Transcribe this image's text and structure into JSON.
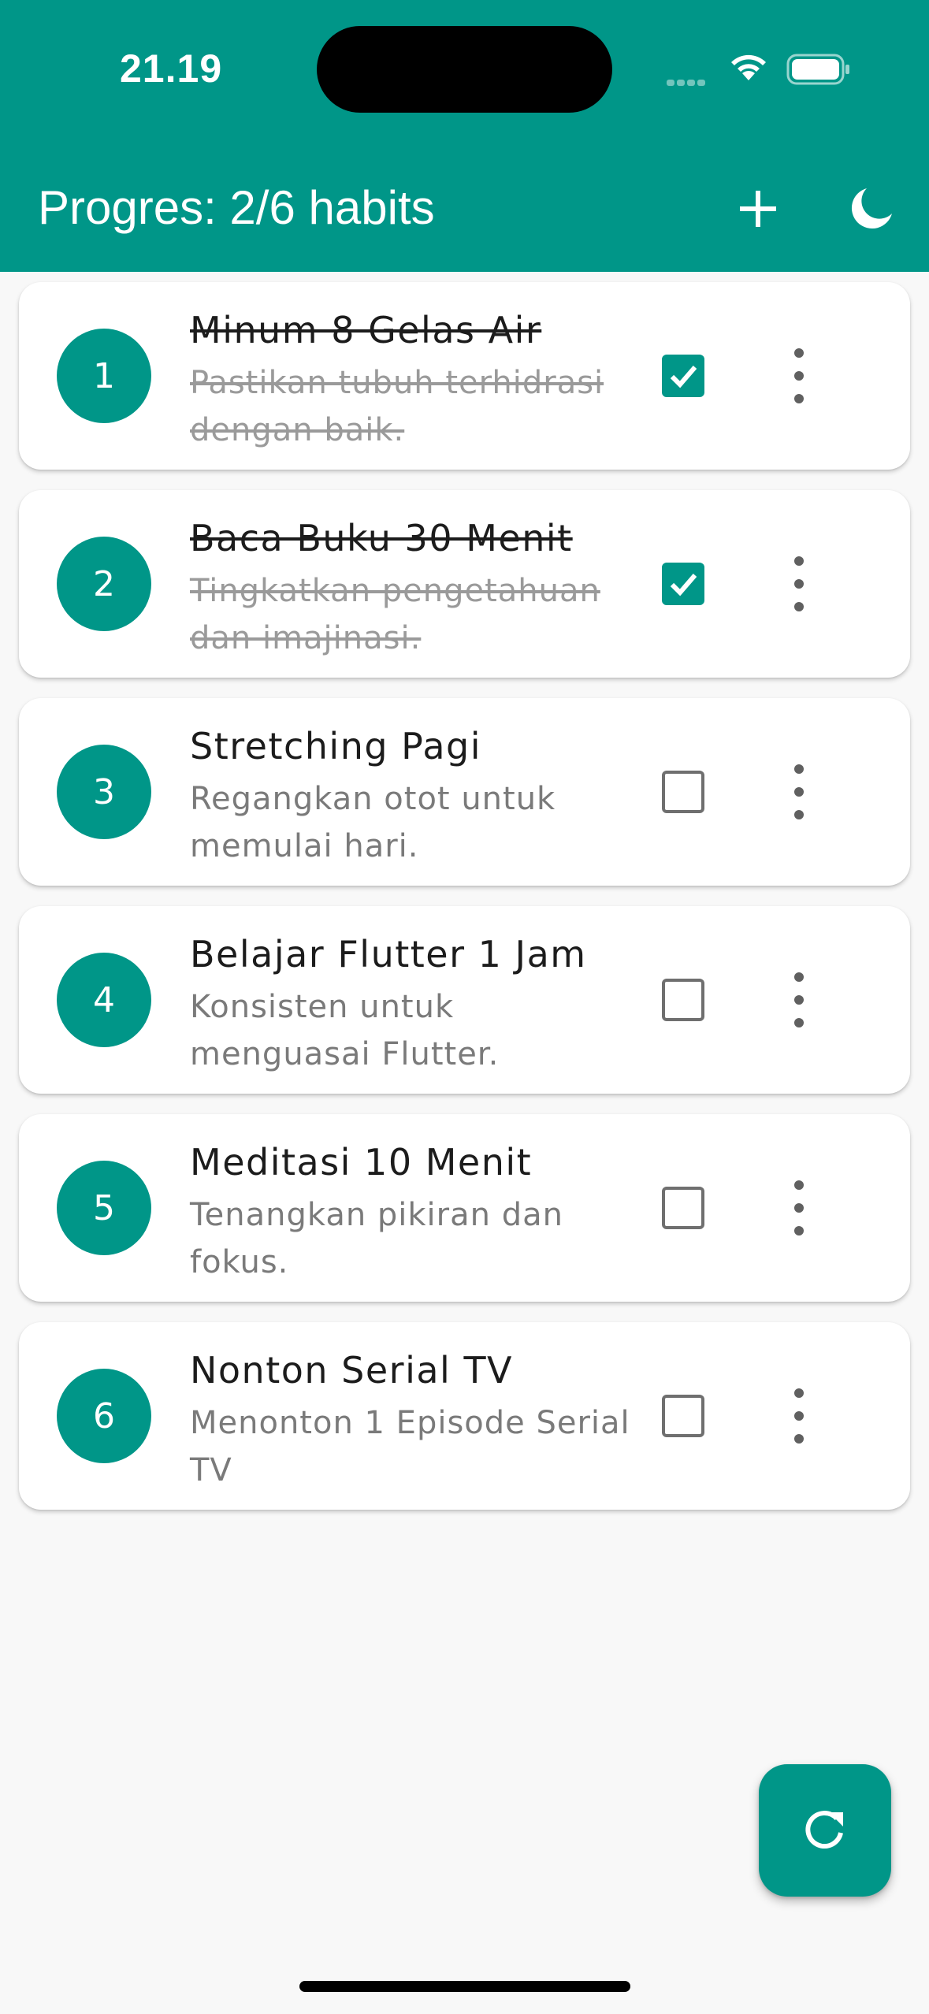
{
  "status_bar": {
    "time": "21.19"
  },
  "app_bar": {
    "title": "Progres: 2/6 habits",
    "add_icon": "plus-icon",
    "theme_icon": "moon-icon"
  },
  "colors": {
    "primary": "#009688",
    "background": "#f8f8f8"
  },
  "habits": [
    {
      "number": "1",
      "title": "Minum 8 Gelas Air",
      "description": "Pastikan tubuh terhidrasi dengan baik.",
      "done": true
    },
    {
      "number": "2",
      "title": "Baca Buku 30 Menit",
      "description": "Tingkatkan pengetahuan dan imajinasi.",
      "done": true
    },
    {
      "number": "3",
      "title": "Stretching Pagi",
      "description": "Regangkan otot untuk memulai hari.",
      "done": false
    },
    {
      "number": "4",
      "title": "Belajar Flutter 1 Jam",
      "description": "Konsisten untuk menguasai Flutter.",
      "done": false
    },
    {
      "number": "5",
      "title": "Meditasi 10 Menit",
      "description": "Tenangkan pikiran dan fokus.",
      "done": false
    },
    {
      "number": "6",
      "title": "Nonton Serial TV",
      "description": "Menonton 1 Episode Serial TV",
      "done": false
    }
  ],
  "fab": {
    "icon": "refresh-icon"
  }
}
